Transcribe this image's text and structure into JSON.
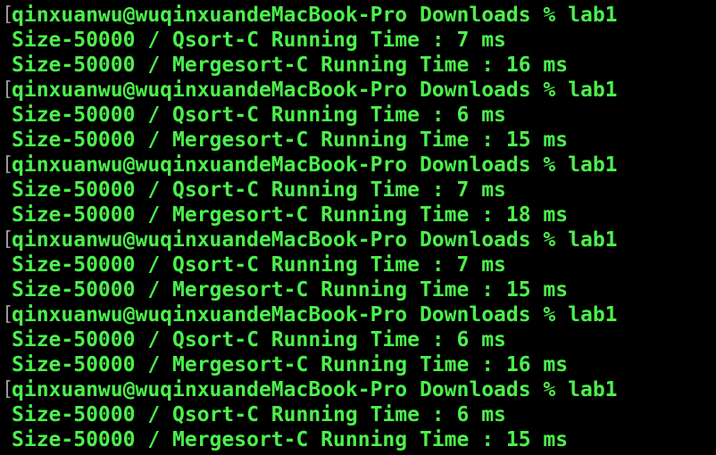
{
  "terminal": {
    "colors": {
      "background": "#000000",
      "text": "#4cf04b",
      "bracket": "#9a9a9a"
    },
    "lines": [
      {
        "type": "prompt",
        "bracket": "[",
        "text": "qinxuanwu@wuqinxuandeMacBook-Pro Downloads % lab1"
      },
      {
        "type": "output",
        "text": "Size-50000 / Qsort-C Running Time : 7 ms"
      },
      {
        "type": "output",
        "text": "Size-50000 / Mergesort-C Running Time : 16 ms"
      },
      {
        "type": "prompt",
        "bracket": "[",
        "text": "qinxuanwu@wuqinxuandeMacBook-Pro Downloads % lab1"
      },
      {
        "type": "output",
        "text": "Size-50000 / Qsort-C Running Time : 6 ms"
      },
      {
        "type": "output",
        "text": "Size-50000 / Mergesort-C Running Time : 15 ms"
      },
      {
        "type": "prompt",
        "bracket": "[",
        "text": "qinxuanwu@wuqinxuandeMacBook-Pro Downloads % lab1"
      },
      {
        "type": "output",
        "text": "Size-50000 / Qsort-C Running Time : 7 ms"
      },
      {
        "type": "output",
        "text": "Size-50000 / Mergesort-C Running Time : 18 ms"
      },
      {
        "type": "prompt",
        "bracket": "[",
        "text": "qinxuanwu@wuqinxuandeMacBook-Pro Downloads % lab1"
      },
      {
        "type": "output",
        "text": "Size-50000 / Qsort-C Running Time : 7 ms"
      },
      {
        "type": "output",
        "text": "Size-50000 / Mergesort-C Running Time : 15 ms"
      },
      {
        "type": "prompt",
        "bracket": "[",
        "text": "qinxuanwu@wuqinxuandeMacBook-Pro Downloads % lab1"
      },
      {
        "type": "output",
        "text": "Size-50000 / Qsort-C Running Time : 6 ms"
      },
      {
        "type": "output",
        "text": "Size-50000 / Mergesort-C Running Time : 16 ms"
      },
      {
        "type": "prompt",
        "bracket": "[",
        "text": "qinxuanwu@wuqinxuandeMacBook-Pro Downloads % lab1"
      },
      {
        "type": "output",
        "text": "Size-50000 / Qsort-C Running Time : 6 ms"
      },
      {
        "type": "output",
        "text": "Size-50000 / Mergesort-C Running Time : 15 ms"
      }
    ]
  }
}
